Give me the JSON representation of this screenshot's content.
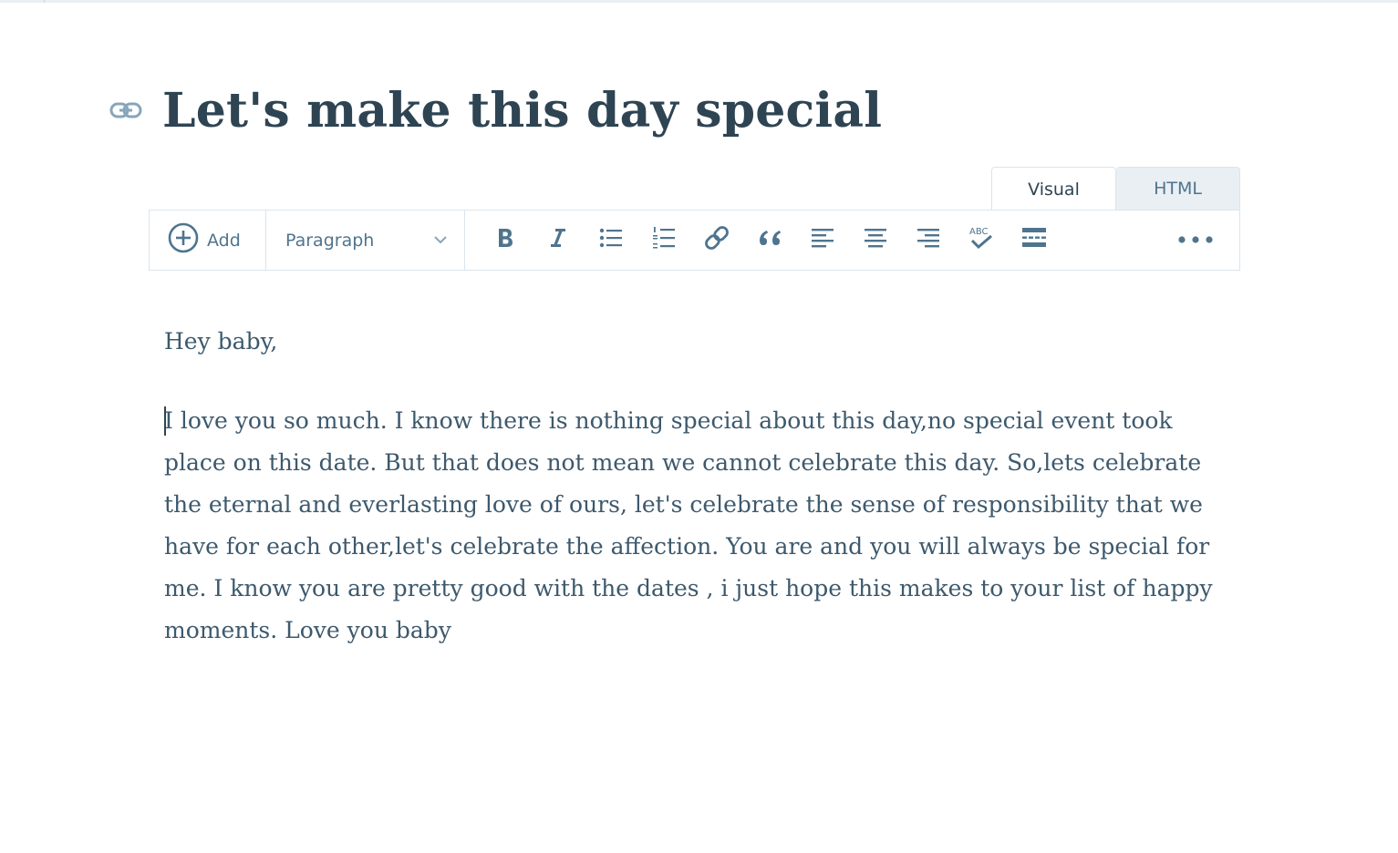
{
  "post": {
    "title": "Let's make this day special"
  },
  "editor": {
    "tabs": {
      "visual": "Visual",
      "html": "HTML"
    },
    "toolbar": {
      "add_label": "Add",
      "format_selected": "Paragraph"
    },
    "content": {
      "paragraphs": [
        "Hey baby,",
        "I love you so much. I know there is nothing special about this day,no special event took place on this date. But that does not mean we cannot celebrate this day. So,lets celebrate the eternal and everlasting love of ours, let's celebrate the sense of responsibility that we have for each other,let's celebrate the affection. You are and you will always be special for me. I know you are pretty good with the dates , i just hope this makes to your list of happy moments. Love you baby"
      ]
    }
  },
  "icons": {
    "permalink": "link-icon",
    "add": "plus-circle-icon",
    "dropdown": "chevron-down-icon",
    "bold": "bold-icon",
    "italic": "italic-icon",
    "bullet_list": "bulleted-list-icon",
    "numbered_list": "numbered-list-icon",
    "link": "link-icon",
    "quote": "blockquote-icon",
    "align_left": "align-left-icon",
    "align_center": "align-center-icon",
    "align_right": "align-right-icon",
    "spellcheck": "spellcheck-icon",
    "read_more": "read-more-icon",
    "more": "more-horizontal-icon"
  },
  "colors": {
    "text_dark": "#2e4453",
    "text_muted": "#4f748e",
    "border": "#dbe5ec",
    "tab_inactive_bg": "#e9eff3"
  }
}
